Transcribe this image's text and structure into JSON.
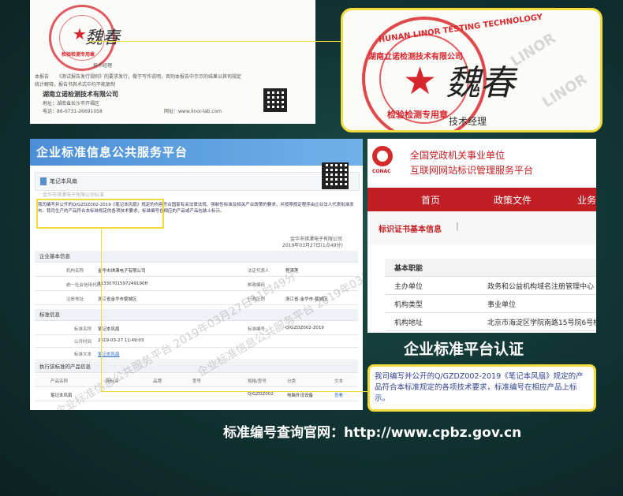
{
  "certificate": {
    "stamp_caption": "检验检测专用章",
    "manager_role": "技术经理",
    "body_prefix": "本报告",
    "body_text": "《测试报告发行规则》的要求发行，做于写作说明，否则本报告中示示的结果以其何规定",
    "body_text2": "统计解释，报告书其术式中均不能复制",
    "company_name": "湖南立诺检测技术有限公司",
    "address": "地址：湖南省长沙市开福区",
    "tel": "电话：86-0731-26691058",
    "website": "网址：www.linor-lab.com"
  },
  "stamp_zoom": {
    "ring_text": "HUNAN LINOR TESTING TECHNOLOGY",
    "company_cn": "湖南立诺检测技术有限公司",
    "bottom_text": "检验检测专用章",
    "manager_role": "技术经理",
    "watermark": "LINOR"
  },
  "platform": {
    "title": "企业标准信息公共服务平台",
    "product_title": "笔记本风扇",
    "company_blur": "金华市琪澤电子有限公司标准",
    "declaration": "我司编写并公开的Q/GZDZ002-2019《笔记本风扇》规定的内容符合国家有关法律法规、强制性标准及相关产业政策的要求，并按照规定程序由企业法人代表批准发布。我司生产的产品符合本标准规定的各项技术要求，标准编号在相应的产品或产品包装上标示。",
    "sign_company": "金华市琪澤电子有限公司",
    "sign_date": "2019年03月27日(1点49分)",
    "section_basic": "企业基本信息",
    "basic_rows": [
      {
        "k1": "机构名称",
        "v1": "金华市琪澤电子有限公司",
        "k2": "法定代表人",
        "v2": "程清莲"
      },
      {
        "k1": "统一社会信用代码",
        "v1": "91330701597249190H",
        "k2": "邮政编码",
        "v2": ""
      },
      {
        "k1": "注册地址",
        "v1": "浙江省金华市婺城区",
        "k2": "行政区划",
        "v2": "浙江省-金华市-婺城区"
      }
    ],
    "section_std": "标准信息",
    "std_rows": [
      {
        "k1": "标准名称",
        "v1": "笔记本风扇",
        "k2": "标准编号",
        "v2": "Q/GZDZ002-2019"
      },
      {
        "k1": "公开时间",
        "v1": "2019-03-27 11:49:03",
        "k2": "",
        "v2": ""
      },
      {
        "k1": "标准文本",
        "v1": "笔记本风扇",
        "k2": "",
        "v2": ""
      }
    ],
    "section_products": "执行该标准的产品信息",
    "product_headers": [
      "产品名称",
      "商标名",
      "品牌",
      "型号",
      "规格/型号",
      "分类",
      "文本"
    ],
    "product_row": [
      "笔记本风扇",
      "",
      "",
      "",
      "Q/GZDZ002",
      "电脑外设设备",
      "查看"
    ],
    "watermark": "企业标准信息公共服务平台 2019年03月27日11时49分"
  },
  "conac": {
    "org_line1": "全国党政机关事业单位",
    "org_line2": "互联网网站标识管理服务平台",
    "logo_text": "CONAC",
    "nav": [
      "首页",
      "政策文件",
      "业务"
    ],
    "section_title": "标识证书基本信息",
    "table_title": "基本职能",
    "rows": [
      {
        "k": "主办单位",
        "v": "政务和公益机构域名注册管理中心"
      },
      {
        "k": "机构类型",
        "v": "事业单位"
      },
      {
        "k": "机构地址",
        "v": "北京市海淀区学院南路15号院6号楼"
      }
    ]
  },
  "captions": {
    "platform_cert": "企业标准平台认证",
    "query_site": "标准编号查询官网：http://www.cpbz.gov.cn"
  },
  "excerpt": {
    "text": "我司编写并公开的Q/GZDZ002-2019《笔记本风扇》规定的产品符合本标准规定的各项技术要求，标准编号在相应产品上标示。",
    "highlight_color": "#f2dc3b"
  }
}
